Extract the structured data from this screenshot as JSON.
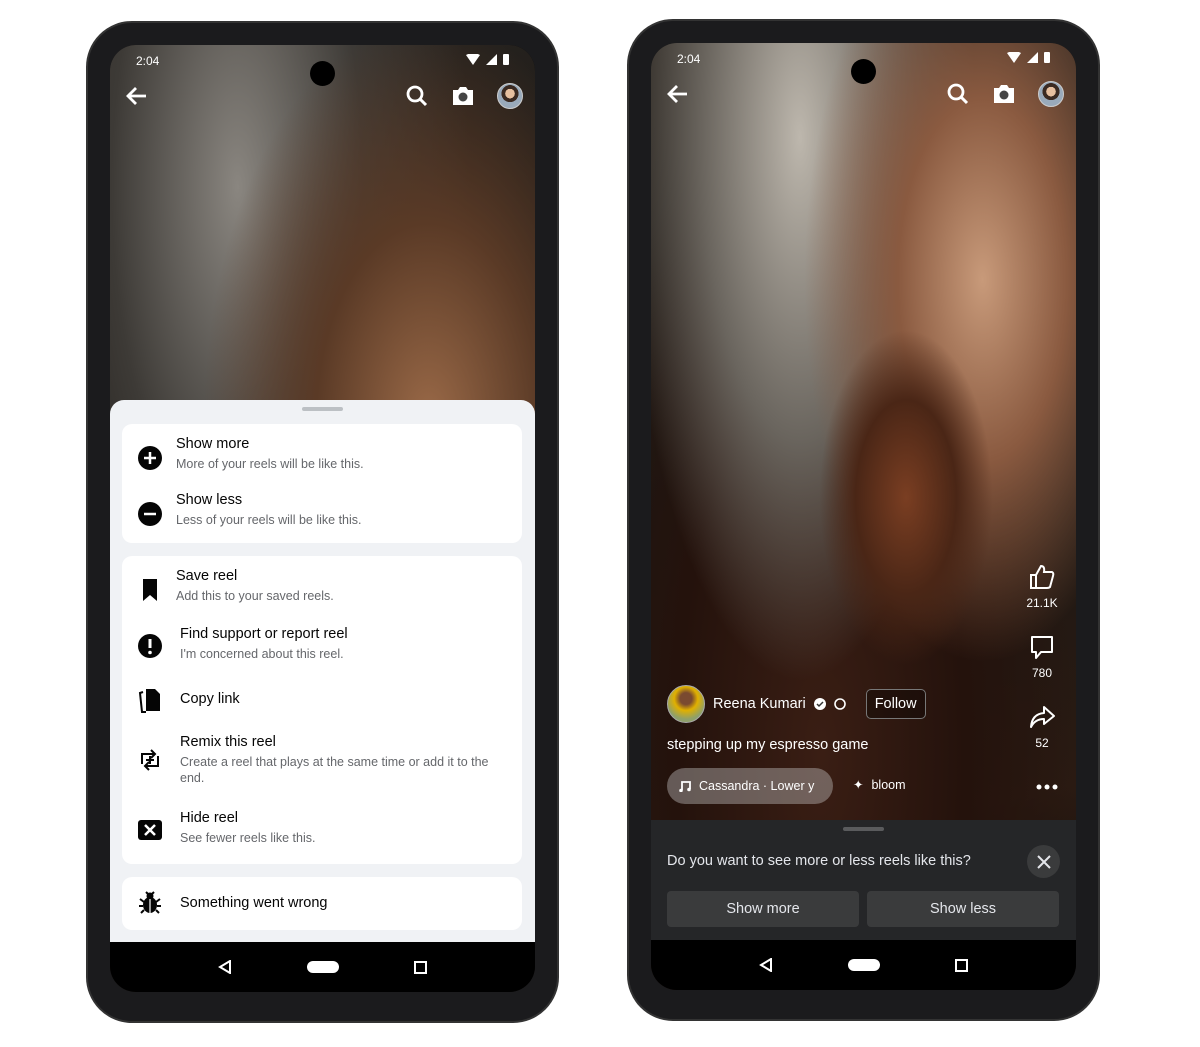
{
  "status_time": "2:04",
  "left": {
    "groups": [
      [
        {
          "icon": "plus-circle-icon",
          "title": "Show more",
          "subtitle": "More of your reels will be like this."
        },
        {
          "icon": "minus-circle-icon",
          "title": "Show less",
          "subtitle": "Less of your reels will be like this."
        }
      ],
      [
        {
          "icon": "bookmark-icon",
          "title": "Save reel",
          "subtitle": "Add this to your saved reels."
        },
        {
          "icon": "exclamation-circle-icon",
          "title": "Find support or report reel",
          "subtitle": "I'm concerned about this reel."
        },
        {
          "icon": "copy-icon",
          "title": "Copy link"
        },
        {
          "icon": "remix-icon",
          "title": "Remix this reel",
          "subtitle": "Create a reel that plays at the same time or add it to the end."
        },
        {
          "icon": "hide-x-icon",
          "title": "Hide reel",
          "subtitle": "See fewer reels like this."
        }
      ],
      [
        {
          "icon": "bug-icon",
          "title": "Something went wrong"
        }
      ]
    ]
  },
  "right": {
    "likes": "21.1K",
    "comments": "780",
    "shares": "52",
    "author": "Reena Kumari",
    "follow": "Follow",
    "caption": "stepping up my espresso game",
    "music": "Cassandra · Lower y",
    "effect": "bloom",
    "prompt": "Do you want to see more or less reels like this?",
    "show_more": "Show more",
    "show_less": "Show less"
  }
}
